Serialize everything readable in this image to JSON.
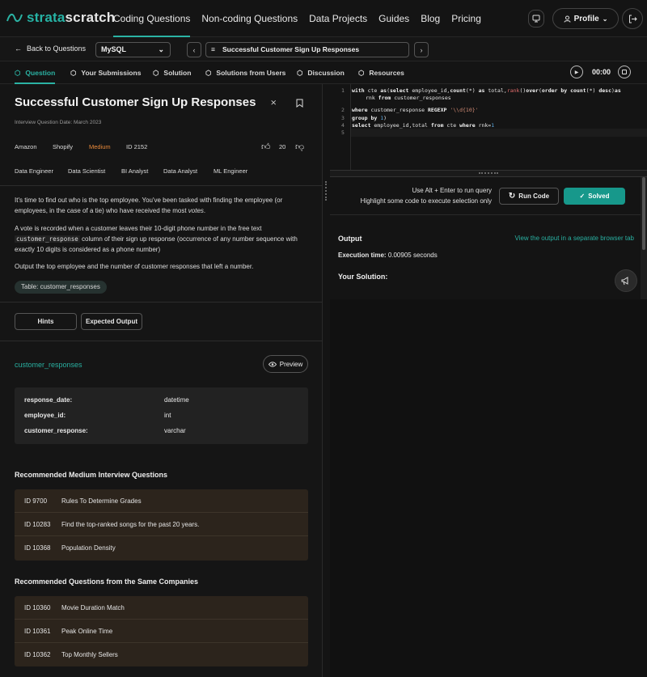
{
  "brand": {
    "name_part1": "strata",
    "name_part2": "scratch",
    "accent": "#2bb3a4"
  },
  "nav": {
    "links": [
      "Coding Questions",
      "Non-coding Questions",
      "Data Projects",
      "Guides",
      "Blog",
      "Pricing"
    ],
    "active_index": 0,
    "profile_label": "Profile"
  },
  "toolbar": {
    "back_label": "Back to Questions",
    "language": "MySQL",
    "question_title": "Successful Customer Sign Up Responses"
  },
  "tabs": {
    "items": [
      "Question",
      "Your Submissions",
      "Solution",
      "Solutions from Users",
      "Discussion",
      "Resources"
    ],
    "active_index": 0,
    "timer": "00:00"
  },
  "question": {
    "title": "Successful Customer Sign Up Responses",
    "date": "Interview Question Date: March 2023",
    "companies": [
      "Amazon",
      "Shopify"
    ],
    "difficulty": "Medium",
    "difficulty_color": "#e8893a",
    "id": "ID 2152",
    "likes": "20",
    "roles": [
      "Data Engineer",
      "Data Scientist",
      "BI Analyst",
      "Data Analyst",
      "ML Engineer"
    ],
    "p1_a": "It's time to find out who is the top employee. You've been tasked with finding the employee (or employees, in the case of a tie) who have received the most ",
    "p1_em": "votes",
    "p1_b": ".",
    "p2_a": "A vote is recorded when a customer leaves their 10-digit phone number in the free text ",
    "p2_code": "customer_response",
    "p2_b": " column of their sign up response (occurrence of any number sequence with exactly 10 digits is considered as a phone number)",
    "p3": "Output the top employee and the number of customer responses that left a number.",
    "table_pill": "Table: customer_responses",
    "hints_label": "Hints",
    "expected_label": "Expected Output"
  },
  "schema": {
    "table_name": "customer_responses",
    "preview_label": "Preview",
    "columns": [
      {
        "name": "response_date:",
        "type": "datetime"
      },
      {
        "name": "employee_id:",
        "type": "int"
      },
      {
        "name": "customer_response:",
        "type": "varchar"
      }
    ]
  },
  "recommended_medium": {
    "heading": "Recommended Medium Interview Questions",
    "items": [
      {
        "id": "ID 9700",
        "name": "Rules To Determine Grades"
      },
      {
        "id": "ID 10283",
        "name": "Find the top-ranked songs for the past 20 years."
      },
      {
        "id": "ID 10368",
        "name": "Population Density"
      }
    ]
  },
  "recommended_same": {
    "heading": "Recommended Questions from the Same Companies",
    "items": [
      {
        "id": "ID 10360",
        "name": "Movie Duration Match"
      },
      {
        "id": "ID 10361",
        "name": "Peak Online Time"
      },
      {
        "id": "ID 10362",
        "name": "Top Monthly Sellers"
      }
    ]
  },
  "editor": {
    "line_numbers": [
      "1",
      "",
      "2",
      "3",
      "4",
      "5"
    ]
  },
  "run": {
    "hint1": "Use Alt + Enter to run query",
    "hint2": "Highlight some code to execute selection only",
    "run_label": "Run Code",
    "solved_label": "Solved"
  },
  "output": {
    "title": "Output",
    "link": "View the output in a separate browser tab",
    "exec_label": "Execution time:",
    "exec_value": "0.00905 seconds",
    "your_solution": "Your Solution:"
  }
}
